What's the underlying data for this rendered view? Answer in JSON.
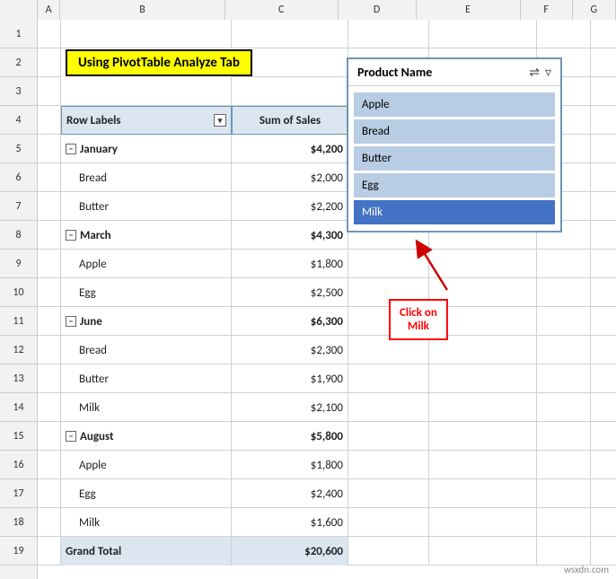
{
  "title": "Using PivotTable Analyze Tab",
  "columns": [
    "",
    "A",
    "B",
    "C",
    "D",
    "E",
    "F",
    "G"
  ],
  "rows": [
    {
      "num": 1,
      "b": "",
      "c": ""
    },
    {
      "num": 2,
      "b": "title",
      "c": ""
    },
    {
      "num": 3,
      "b": "",
      "c": ""
    },
    {
      "num": 4,
      "b": "Row Labels",
      "c": "Sum of Sales",
      "type": "header"
    },
    {
      "num": 5,
      "b": "January",
      "c": "$4,200",
      "type": "month"
    },
    {
      "num": 6,
      "b": "Bread",
      "c": "$2,000",
      "type": "sub"
    },
    {
      "num": 7,
      "b": "Butter",
      "c": "$2,200",
      "type": "sub"
    },
    {
      "num": 8,
      "b": "March",
      "c": "$4,300",
      "type": "month"
    },
    {
      "num": 9,
      "b": "Apple",
      "c": "$1,800",
      "type": "sub"
    },
    {
      "num": 10,
      "b": "Egg",
      "c": "$2,500",
      "type": "sub"
    },
    {
      "num": 11,
      "b": "June",
      "c": "$6,300",
      "type": "month"
    },
    {
      "num": 12,
      "b": "Bread",
      "c": "$2,300",
      "type": "sub"
    },
    {
      "num": 13,
      "b": "Butter",
      "c": "$1,900",
      "type": "sub"
    },
    {
      "num": 14,
      "b": "Milk",
      "c": "$2,100",
      "type": "sub"
    },
    {
      "num": 15,
      "b": "August",
      "c": "$5,800",
      "type": "month"
    },
    {
      "num": 16,
      "b": "Apple",
      "c": "$1,800",
      "type": "sub"
    },
    {
      "num": 17,
      "b": "Egg",
      "c": "$2,400",
      "type": "sub"
    },
    {
      "num": 18,
      "b": "Milk",
      "c": "$1,600",
      "type": "sub"
    },
    {
      "num": 19,
      "b": "Grand Total",
      "c": "$20,600",
      "type": "total"
    }
  ],
  "filterPanel": {
    "title": "Product Name",
    "items": [
      "Apple",
      "Bread",
      "Butter",
      "Egg",
      "Milk"
    ]
  },
  "callout": {
    "line1": "Click on",
    "line2": "Milk"
  },
  "watermark": "wsxdn.com"
}
